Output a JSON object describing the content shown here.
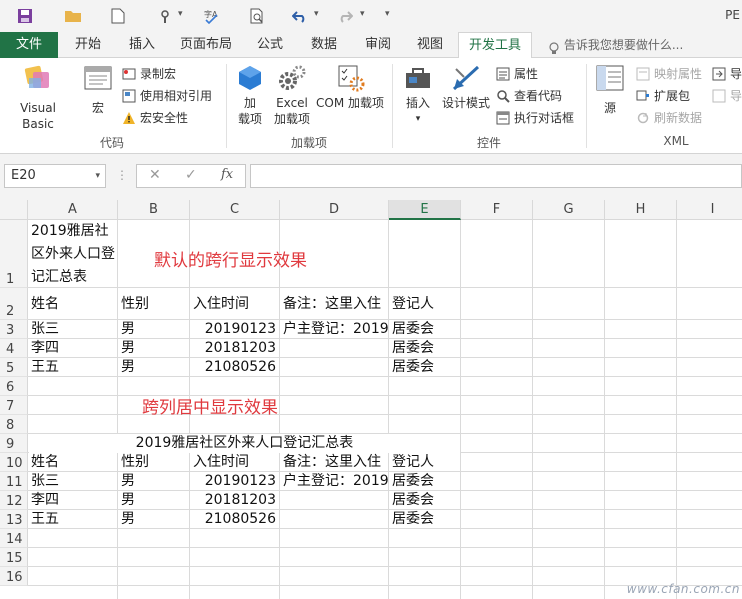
{
  "app": {
    "title": "PE"
  },
  "qat": {
    "items": [
      "save-icon",
      "open-folder-icon",
      "new-file-icon",
      "touch-mode-icon",
      "spelling-icon",
      "print-preview-icon",
      "undo-icon",
      "redo-icon",
      "customize-icon"
    ]
  },
  "tabs": [
    "文件",
    "开始",
    "插入",
    "页面布局",
    "公式",
    "数据",
    "审阅",
    "视图",
    "开发工具"
  ],
  "tell_me": "告诉我您想要做什么...",
  "ribbon": {
    "code": {
      "label": "代码",
      "visual_basic": "Visual Basic",
      "macros": "宏",
      "record_macro": "录制宏",
      "relative_ref": "使用相对引用",
      "macro_security": "宏安全性"
    },
    "addins": {
      "label": "加载项",
      "addins_line1": "加",
      "addins_line2": "载项",
      "excel_addins_line1": "Excel",
      "excel_addins_line2": "加载项",
      "com_addins": "COM 加载项"
    },
    "controls": {
      "label": "控件",
      "insert": "插入",
      "design_mode": "设计模式",
      "properties": "属性",
      "view_code": "查看代码",
      "run_dialog": "执行对话框"
    },
    "xml": {
      "label": "XML",
      "source": "源",
      "map_properties": "映射属性",
      "expansion_packs": "扩展包",
      "refresh_data": "刷新数据",
      "import": "导",
      "export": "导"
    }
  },
  "formula_bar": {
    "name_box": "E20",
    "fx": "fx",
    "value": ""
  },
  "columns": [
    "A",
    "B",
    "C",
    "D",
    "E",
    "F",
    "G",
    "H",
    "I"
  ],
  "rows": [
    "1",
    "2",
    "3",
    "4",
    "5",
    "6",
    "7",
    "8",
    "9",
    "10",
    "11",
    "12",
    "13",
    "14",
    "15",
    "16"
  ],
  "sheet": {
    "r1_a": "2019雅居社区外来人口登记汇总表",
    "header": [
      "姓名",
      "性别",
      "入住时间",
      "备注：这里入住",
      "登记人"
    ],
    "data": [
      [
        "张三",
        "男",
        "20190123",
        "户主登记：2019",
        "居委会"
      ],
      [
        "李四",
        "男",
        "20181203",
        "",
        "居委会"
      ],
      [
        "王五",
        "男",
        "21080526",
        "",
        "居委会"
      ]
    ],
    "r9_title": "2019雅居社区外来人口登记汇总表"
  },
  "notes": {
    "wrap_default": "默认的跨行显示效果",
    "center_across": "跨列居中显示效果"
  },
  "watermark": "www.cfan.com.cn",
  "colors": {
    "accent": "#217346",
    "note": "#e0393e"
  }
}
